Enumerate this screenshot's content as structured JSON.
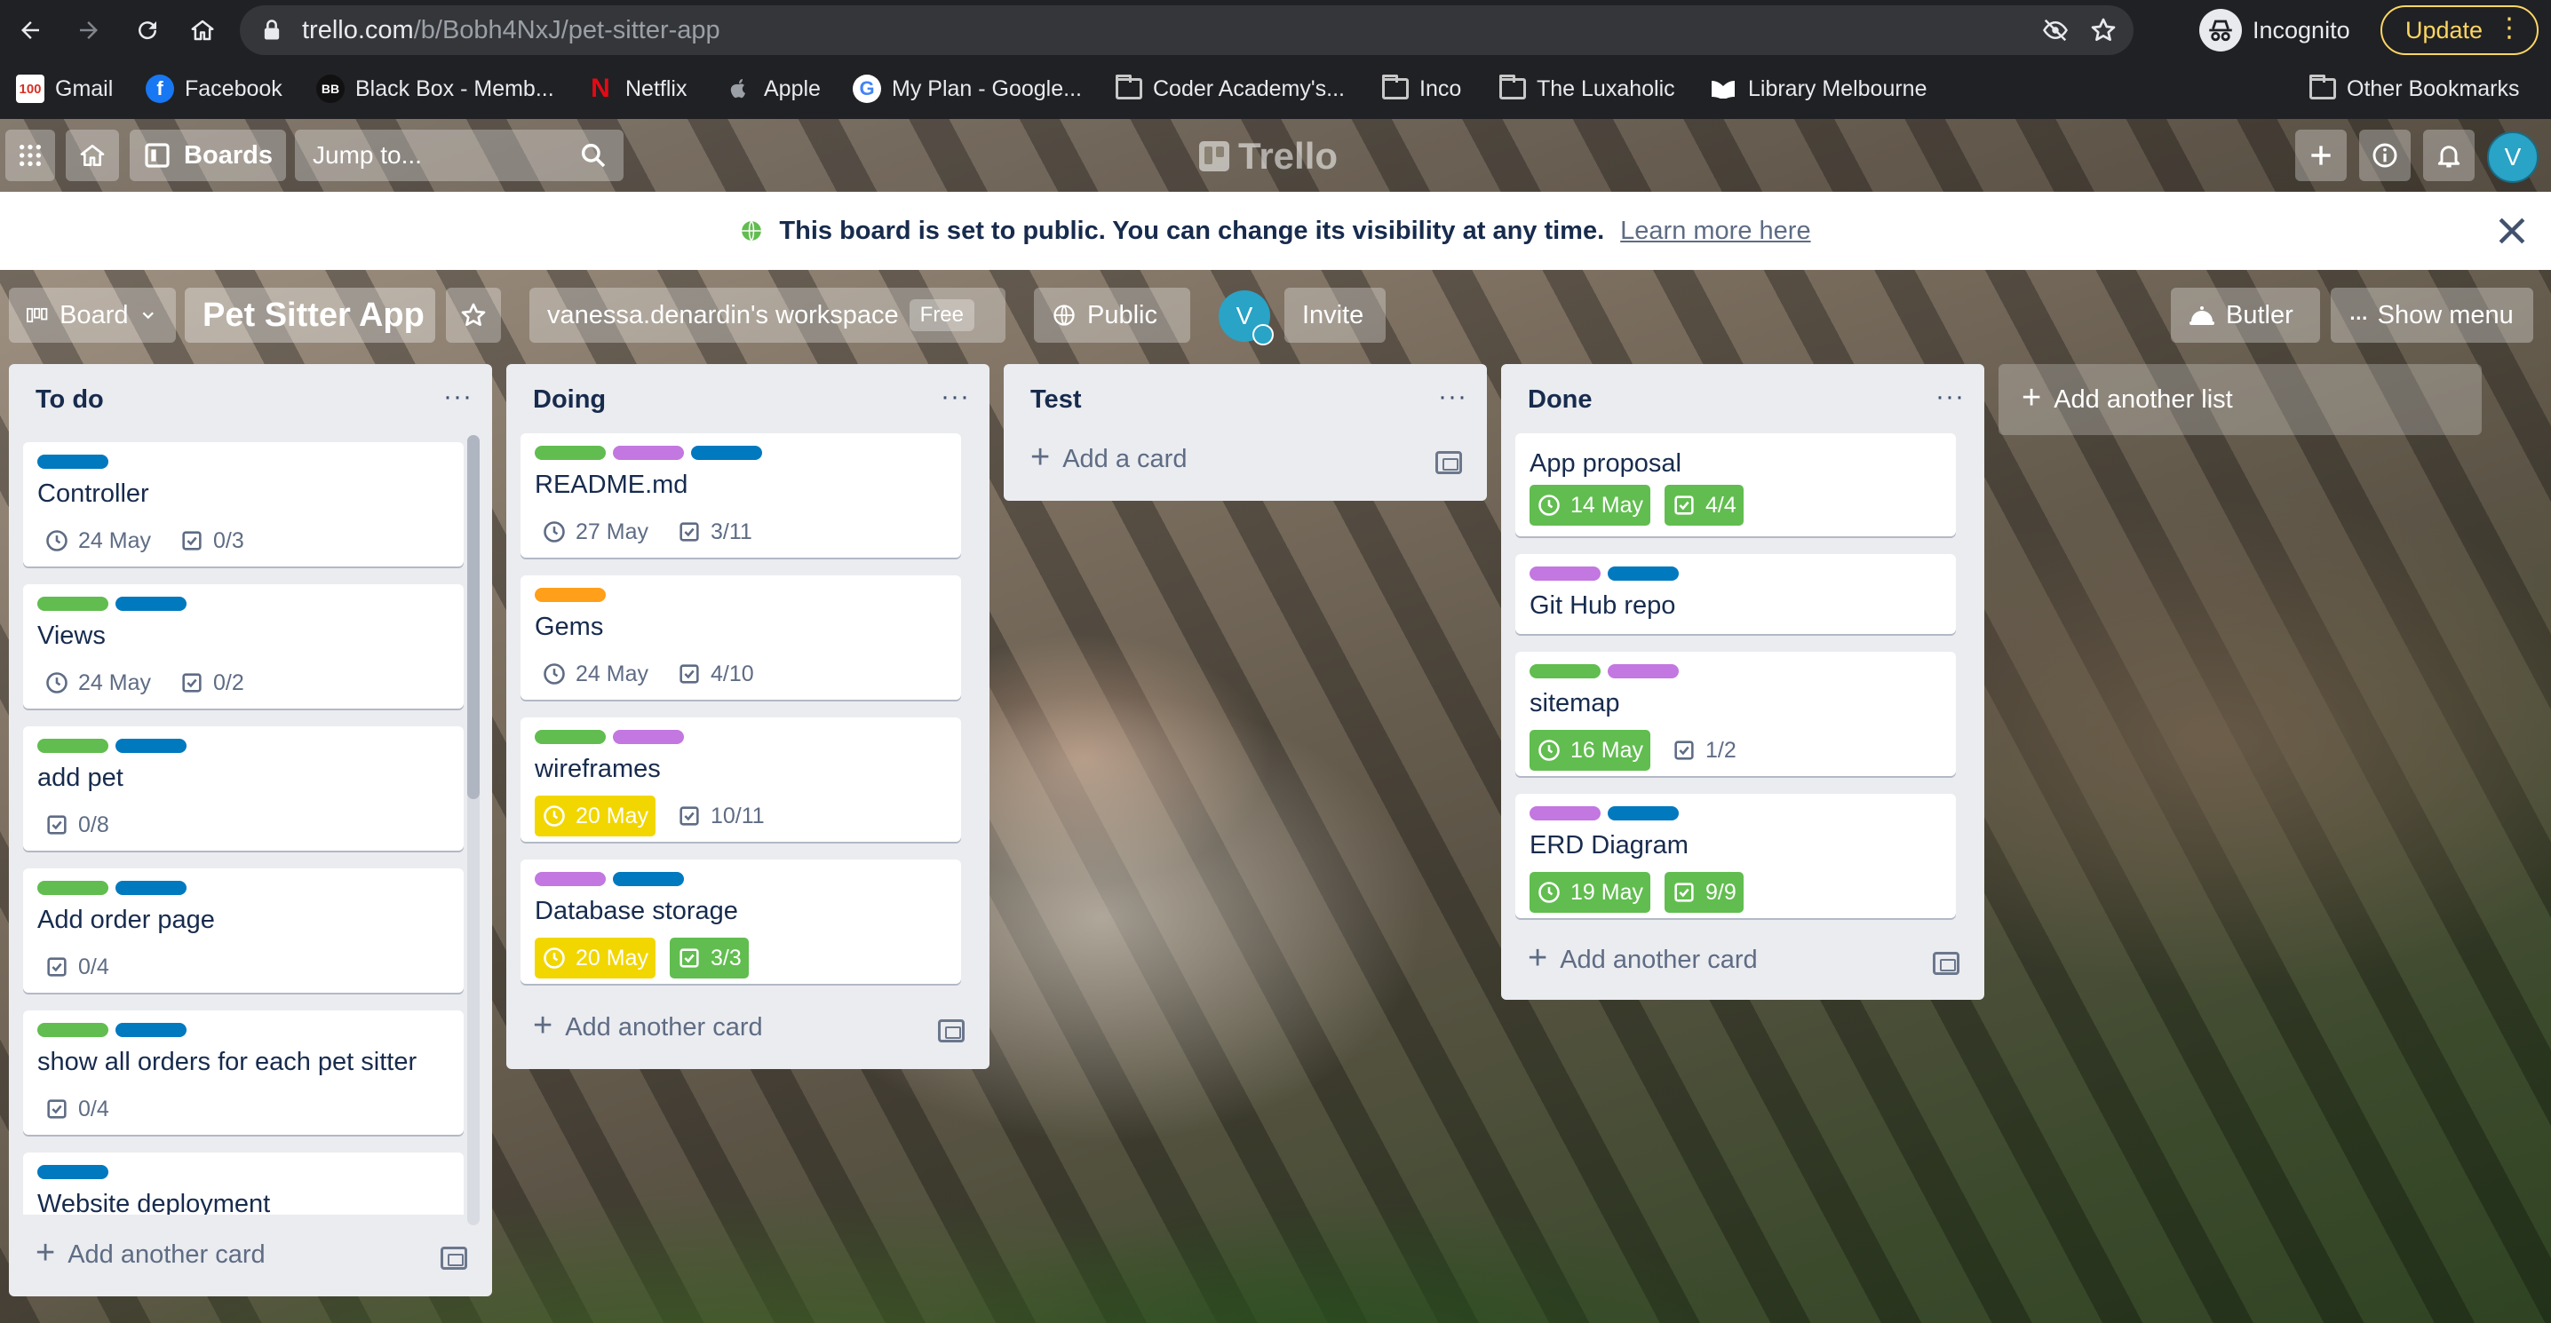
{
  "browser": {
    "url_domain": "trello.com",
    "url_path": "/b/Bobh4NxJ/pet-sitter-app",
    "profile": "Incognito",
    "update_label": "Update",
    "bookmarks": [
      {
        "label": "Gmail",
        "icon": "gmail-icon"
      },
      {
        "label": "Facebook",
        "icon": "facebook-icon"
      },
      {
        "label": "Black Box - Memb...",
        "icon": "blackbox-icon"
      },
      {
        "label": "Netflix",
        "icon": "netflix-icon"
      },
      {
        "label": "Apple",
        "icon": "apple-icon"
      },
      {
        "label": "My Plan - Google...",
        "icon": "google-icon"
      },
      {
        "label": "Coder Academy's...",
        "icon": "folder-icon"
      },
      {
        "label": "Inco",
        "icon": "folder-icon"
      },
      {
        "label": "The Luxaholic",
        "icon": "folder-icon"
      },
      {
        "label": "Library Melbourne",
        "icon": "library-icon"
      }
    ],
    "other_bookmarks": "Other Bookmarks",
    "badges": {
      "gmail": "100",
      "blackbox": "BB",
      "google": "G",
      "netflix": "N"
    }
  },
  "header": {
    "boards_label": "Boards",
    "search_placeholder": "Jump to...",
    "logo": "Trello",
    "avatar_initial": "V"
  },
  "banner": {
    "text": "This board is set to public. You can change its visibility at any time.",
    "link": "Learn more here"
  },
  "board": {
    "view_label": "Board",
    "name": "Pet Sitter App",
    "workspace": "vanessa.denardin's workspace",
    "plan": "Free",
    "visibility": "Public",
    "member_initial": "V",
    "invite_label": "Invite",
    "butler_label": "Butler",
    "menu_label": "Show menu",
    "add_list_label": "Add another list"
  },
  "colors": {
    "green": "#61bd4f",
    "purple": "#c377e0",
    "blue": "#0079bf",
    "orange": "#ff9f1a",
    "yellow": "#f2d600"
  },
  "lists": [
    {
      "title": "To do",
      "add_label": "Add another card",
      "cards": [
        {
          "title": "Controller",
          "labels": [
            "blue"
          ],
          "due": "24 May",
          "checklist": "0/3"
        },
        {
          "title": "Views",
          "labels": [
            "green",
            "blue"
          ],
          "due": "24 May",
          "checklist": "0/2"
        },
        {
          "title": "add pet",
          "labels": [
            "green",
            "blue"
          ],
          "checklist": "0/8"
        },
        {
          "title": "Add order page",
          "labels": [
            "green",
            "blue"
          ],
          "checklist": "0/4"
        },
        {
          "title": "show all orders for each pet sitter",
          "labels": [
            "green",
            "blue"
          ],
          "checklist": "0/4"
        },
        {
          "title": "Website deployment",
          "labels": [
            "blue"
          ]
        }
      ]
    },
    {
      "title": "Doing",
      "add_label": "Add another card",
      "cards": [
        {
          "title": "README.md",
          "labels": [
            "green",
            "purple",
            "blue"
          ],
          "due": "27 May",
          "checklist": "3/11"
        },
        {
          "title": "Gems",
          "labels": [
            "orange"
          ],
          "due": "24 May",
          "checklist": "4/10"
        },
        {
          "title": "wireframes",
          "labels": [
            "green",
            "purple"
          ],
          "due": "20 May",
          "due_state": "yellow",
          "checklist": "10/11"
        },
        {
          "title": "Database storage",
          "labels": [
            "purple",
            "blue"
          ],
          "due": "20 May",
          "due_state": "yellow",
          "checklist": "3/3",
          "checklist_state": "green"
        }
      ]
    },
    {
      "title": "Test",
      "add_label": "Add a card",
      "cards": []
    },
    {
      "title": "Done",
      "add_label": "Add another card",
      "cards": [
        {
          "title": "App proposal",
          "labels": [],
          "due": "14 May",
          "due_state": "green",
          "checklist": "4/4",
          "checklist_state": "green"
        },
        {
          "title": "Git Hub repo",
          "labels": [
            "purple",
            "blue"
          ]
        },
        {
          "title": "sitemap",
          "labels": [
            "green",
            "purple"
          ],
          "due": "16 May",
          "due_state": "green",
          "checklist": "1/2"
        },
        {
          "title": "ERD Diagram",
          "labels": [
            "purple",
            "blue"
          ],
          "due": "19 May",
          "due_state": "green",
          "checklist": "9/9",
          "checklist_state": "green"
        }
      ]
    }
  ]
}
